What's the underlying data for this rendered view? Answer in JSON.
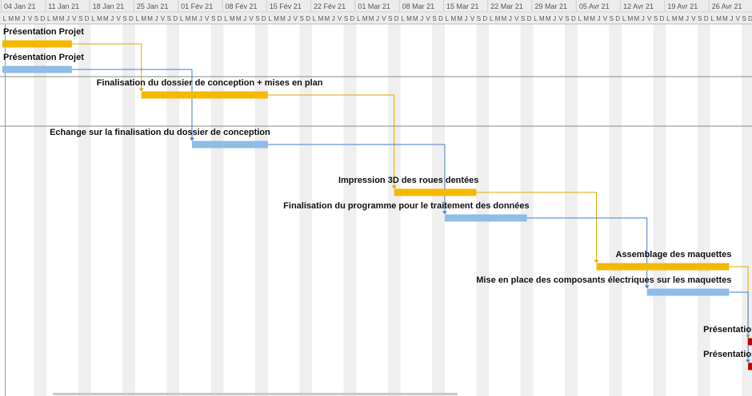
{
  "timescale": {
    "weeks": [
      "04 Jan 21",
      "11 Jan 21",
      "18 Jan 21",
      "25 Jan 21",
      "01 Fév 21",
      "08 Fév 21",
      "15 Fév 21",
      "22 Fév 21",
      "01 Mar 21",
      "08 Mar 21",
      "15 Mar 21",
      "22 Mar 21",
      "29 Mar 21",
      "05 Avr 21",
      "12 Avr 21",
      "19 Avr 21",
      "26 Avr 21"
    ],
    "day_letters": [
      "L",
      "M",
      "M",
      "J",
      "V",
      "S",
      "D"
    ]
  },
  "colors": {
    "gold": "#f5b800",
    "blue": "#8fbce8",
    "red": "#c00000",
    "gold_link": "#e0a800",
    "blue_link": "#3f7fd0",
    "weekend_shade": "#efefef",
    "header_bg": "#ececec",
    "header_text": "#555555",
    "separator": "#8a8a8a",
    "today_line": "#9a9a9a"
  },
  "tasks": [
    {
      "id": "t1",
      "label": "Présentation Projet",
      "start": 0,
      "end": 11,
      "color": "gold",
      "label_mode": "left"
    },
    {
      "id": "t2",
      "label": "Présentation Projet",
      "start": 0,
      "end": 11,
      "color": "blue",
      "label_mode": "left"
    },
    {
      "id": "t3",
      "label": "Finalisation du dossier de conception + mises en plan",
      "start": 22,
      "end": 42,
      "color": "gold",
      "label_mode": "start"
    },
    {
      "id": "t4",
      "label": "Echange sur la finalisation du dossier de conception",
      "start": 30,
      "end": 42,
      "color": "blue",
      "label_mode": "end"
    },
    {
      "id": "t5",
      "label": "Impression 3D des roues dentées",
      "start": 62,
      "end": 75,
      "color": "gold",
      "label_mode": "end"
    },
    {
      "id": "t6",
      "label": "Finalisation du programme pour le traitement des données",
      "start": 70,
      "end": 83,
      "color": "blue",
      "label_mode": "end"
    },
    {
      "id": "t7",
      "label": "Assemblage des maquettes",
      "start": 94,
      "end": 115,
      "color": "gold",
      "label_mode": "end"
    },
    {
      "id": "t8",
      "label": "Mise en place des composants électriques sur les maquettes",
      "start": 102,
      "end": 115,
      "color": "blue",
      "label_mode": "end"
    },
    {
      "id": "t9",
      "label": "Présentation finale",
      "start": 118,
      "end": 123,
      "color": "red",
      "label_mode": "end"
    },
    {
      "id": "t10",
      "label": "Présentation finale",
      "start": 118,
      "end": 123,
      "color": "red",
      "label_mode": "end"
    }
  ],
  "links": [
    {
      "from": "t1",
      "to": "t3",
      "color": "gold_link"
    },
    {
      "from": "t2",
      "to": "t4",
      "color": "blue_link"
    },
    {
      "from": "t3",
      "to": "t5",
      "color": "gold_link"
    },
    {
      "from": "t4",
      "to": "t6",
      "color": "blue_link"
    },
    {
      "from": "t5",
      "to": "t7",
      "color": "gold_link"
    },
    {
      "from": "t6",
      "to": "t8",
      "color": "blue_link"
    },
    {
      "from": "t7",
      "to": "t9",
      "color": "gold_link"
    },
    {
      "from": "t8",
      "to": "t10",
      "color": "blue_link"
    }
  ],
  "today_day": 123
}
